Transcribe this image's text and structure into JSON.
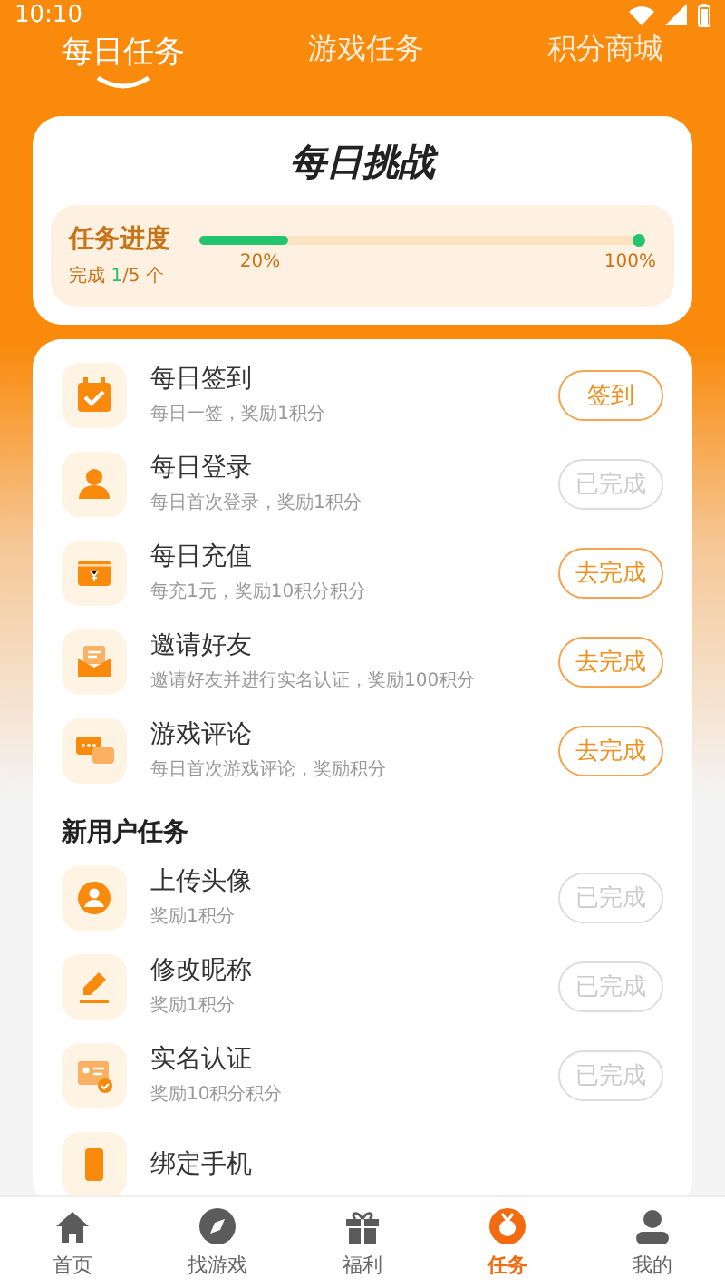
{
  "status_bar": {
    "time": "10:10"
  },
  "tabs": [
    {
      "label": "每日任务",
      "selected": true
    },
    {
      "label": "游戏任务",
      "selected": false
    },
    {
      "label": "积分商城",
      "selected": false
    }
  ],
  "challenge": {
    "title": "每日挑战",
    "progress_label": "任务进度",
    "completed_prefix": "完成",
    "completed_count": "1",
    "completed_suffix": "/5 个",
    "level": 0.2,
    "current_percent": "20%",
    "end_percent": "100%"
  },
  "daily_tasks": [
    {
      "kind": "calendar",
      "title": "每日签到",
      "desc": "每日一签，奖励1积分",
      "action": "签到",
      "done": false
    },
    {
      "kind": "person",
      "title": "每日登录",
      "desc": "每日首次登录，奖励1积分",
      "action": "已完成",
      "done": true
    },
    {
      "kind": "wallet",
      "title": "每日充值",
      "desc": "每充1元，奖励10积分积分",
      "action": "去完成",
      "done": false
    },
    {
      "kind": "mail",
      "title": "邀请好友",
      "desc": "邀请好友并进行实名认证，奖励100积分",
      "action": "去完成",
      "done": false
    },
    {
      "kind": "chat",
      "title": "游戏评论",
      "desc": "每日首次游戏评论，奖励积分",
      "action": "去完成",
      "done": false
    }
  ],
  "new_user_section": {
    "title": "新用户任务"
  },
  "new_user_tasks": [
    {
      "kind": "avatar",
      "title": "上传头像",
      "desc": "奖励1积分",
      "action": "已完成",
      "done": true
    },
    {
      "kind": "pencil",
      "title": "修改昵称",
      "desc": "奖励1积分",
      "action": "已完成",
      "done": true
    },
    {
      "kind": "idcard",
      "title": "实名认证",
      "desc": "奖励10积分积分",
      "action": "已完成",
      "done": true
    },
    {
      "kind": "phone",
      "title": "绑定手机"
    }
  ],
  "bottom_nav": [
    {
      "kind": "home",
      "label": "首页",
      "selected": false
    },
    {
      "kind": "compass",
      "label": "找游戏",
      "selected": false
    },
    {
      "kind": "gift",
      "label": "福利",
      "selected": false
    },
    {
      "kind": "task",
      "label": "任务",
      "selected": true
    },
    {
      "kind": "user",
      "label": "我的",
      "selected": false
    }
  ]
}
